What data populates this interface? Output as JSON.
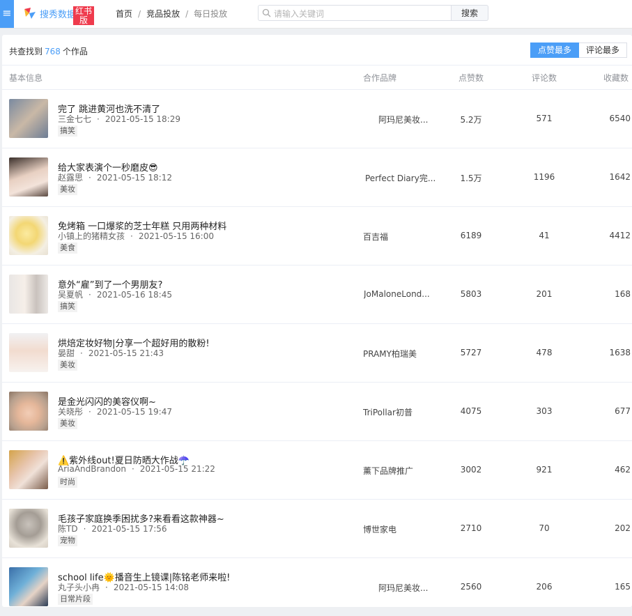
{
  "app": {
    "logo_text": "搜秀数据",
    "badge": "红书版",
    "menu_icon": "hamburger-menu-icon"
  },
  "breadcrumb": [
    "首页",
    "竞品投放",
    "每日投放"
  ],
  "search": {
    "placeholder": "请输入关键词",
    "value": "",
    "button_label": "搜索"
  },
  "summary": {
    "prefix": "共查找到",
    "count": "768",
    "suffix": "个作品"
  },
  "sort_buttons": [
    "点赞最多",
    "评论最多"
  ],
  "columns": {
    "basic": "基本信息",
    "brand": "合作品牌",
    "likes": "点赞数",
    "comments": "评论数",
    "favorites": "收藏数"
  },
  "colors": {
    "accent": "#4b9ef7",
    "badge": "#ef3b4d"
  },
  "rows": [
    {
      "title": "完了 跳进黄河也洗不清了",
      "author": "三金七七",
      "date": "2021-05-15 18:29",
      "tag": "搞笑",
      "brand": "阿玛尼美妆...",
      "likes": "5.2万",
      "comments": "571",
      "favorites": "6540"
    },
    {
      "title": "给大家表演个一秒磨皮😎",
      "author": "赵露思",
      "date": "2021-05-15 18:12",
      "tag": "美妆",
      "brand": "Perfect Diary完...",
      "likes": "1.5万",
      "comments": "1196",
      "favorites": "1642"
    },
    {
      "title": "免烤箱 一口爆浆的芝士年糕 只用两种材料",
      "author": "小镇上的猪精女孩",
      "date": "2021-05-15 16:00",
      "tag": "美食",
      "brand": "百吉福",
      "likes": "6189",
      "comments": "41",
      "favorites": "4412"
    },
    {
      "title": "意外“雇”到了一个男朋友?",
      "author": "吴夏帆",
      "date": "2021-05-16 18:45",
      "tag": "搞笑",
      "brand": "JoMaloneLond...",
      "likes": "5803",
      "comments": "201",
      "favorites": "168"
    },
    {
      "title": "烘焙定妆好物|分享一个超好用的散粉!",
      "author": "晏甜",
      "date": "2021-05-15 21:43",
      "tag": "美妆",
      "brand": "PRAMY柏瑞美",
      "likes": "5727",
      "comments": "478",
      "favorites": "1638"
    },
    {
      "title": "是金光闪闪的美容仪啊~",
      "author": "关晓彤",
      "date": "2021-05-15 19:47",
      "tag": "美妆",
      "brand": "TriPollar初普",
      "likes": "4075",
      "comments": "303",
      "favorites": "677"
    },
    {
      "title": "⚠️紫外线out!夏日防晒大作战☂️",
      "author": "AriaAndBrandon",
      "date": "2021-05-15 21:22",
      "tag": "时尚",
      "brand": "薰下品牌推广",
      "likes": "3002",
      "comments": "921",
      "favorites": "462"
    },
    {
      "title": "毛孩子家庭换季困扰多?来看看这款神器~",
      "author": "陈TD",
      "date": "2021-05-15 17:56",
      "tag": "宠物",
      "brand": "博世家电",
      "likes": "2710",
      "comments": "70",
      "favorites": "202"
    },
    {
      "title": "school life🌞播音生上镜课|陈铭老师来啦!",
      "author": "丸子头小冉",
      "date": "2021-05-15 14:08",
      "tag": "日常片段",
      "brand": "阿玛尼美妆...",
      "likes": "2560",
      "comments": "206",
      "favorites": "165"
    }
  ]
}
